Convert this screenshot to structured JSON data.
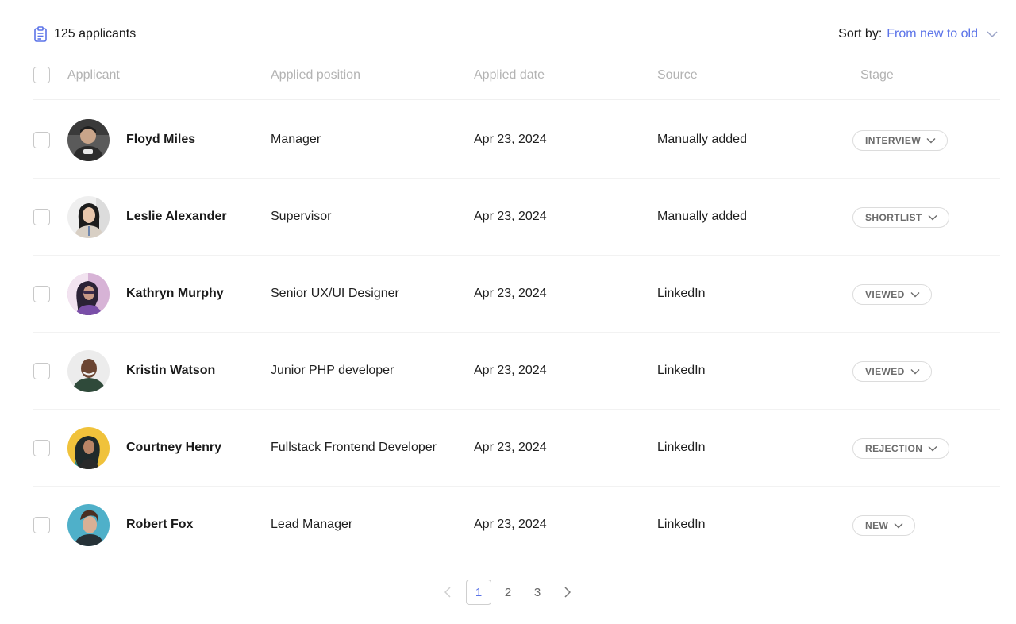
{
  "summary": {
    "count_text": "125 applicants",
    "icon": "clipboard-icon"
  },
  "sort": {
    "label": "Sort by:",
    "value": "From new to old"
  },
  "columns": {
    "applicant": "Applicant",
    "position": "Applied position",
    "date": "Applied date",
    "source": "Source",
    "stage": "Stage"
  },
  "rows": [
    {
      "name": "Floyd Miles",
      "position": "Manager",
      "date": "Apr 23, 2024",
      "source": "Manually added",
      "stage": "INTERVIEW"
    },
    {
      "name": "Leslie Alexander",
      "position": "Supervisor",
      "date": "Apr 23, 2024",
      "source": "Manually added",
      "stage": "SHORTLIST"
    },
    {
      "name": "Kathryn Murphy",
      "position": "Senior UX/UI Designer",
      "date": "Apr 23, 2024",
      "source": "LinkedIn",
      "stage": "VIEWED"
    },
    {
      "name": "Kristin Watson",
      "position": "Junior PHP developer",
      "date": "Apr 23, 2024",
      "source": "LinkedIn",
      "stage": "VIEWED"
    },
    {
      "name": "Courtney Henry",
      "position": "Fullstack Frontend Developer",
      "date": "Apr 23, 2024",
      "source": "LinkedIn",
      "stage": "REJECTION"
    },
    {
      "name": "Robert Fox",
      "position": "Lead Manager",
      "date": "Apr 23, 2024",
      "source": "LinkedIn",
      "stage": "NEW"
    }
  ],
  "pagination": {
    "pages": [
      "1",
      "2",
      "3"
    ],
    "current": "1"
  },
  "colors": {
    "accent": "#5b73e8",
    "muted": "#b3b3b3",
    "border": "#dcdcdc"
  }
}
